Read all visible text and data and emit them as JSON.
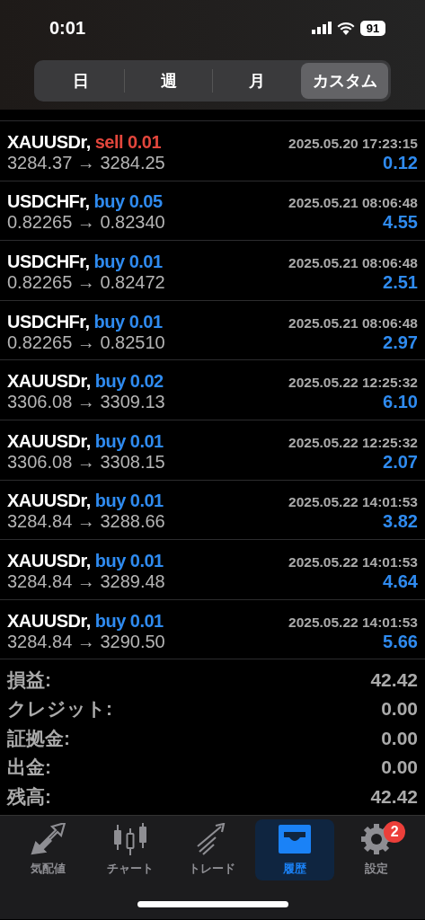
{
  "status_bar": {
    "time": "0:01",
    "battery": "91"
  },
  "period_tabs": [
    {
      "label": "日",
      "selected": false
    },
    {
      "label": "週",
      "selected": false
    },
    {
      "label": "月",
      "selected": false
    },
    {
      "label": "カスタム",
      "selected": true
    }
  ],
  "trades": [
    {
      "symbol": "XAUUSDr,",
      "side": "sell",
      "lot": "0.01",
      "time": "2025.05.20 17:23:15",
      "prices": "3284.37 → 3284.25",
      "profit": "0.12"
    },
    {
      "symbol": "USDCHFr,",
      "side": "buy",
      "lot": "0.05",
      "time": "2025.05.21 08:06:48",
      "prices": "0.82265 → 0.82340",
      "profit": "4.55"
    },
    {
      "symbol": "USDCHFr,",
      "side": "buy",
      "lot": "0.01",
      "time": "2025.05.21 08:06:48",
      "prices": "0.82265 → 0.82472",
      "profit": "2.51"
    },
    {
      "symbol": "USDCHFr,",
      "side": "buy",
      "lot": "0.01",
      "time": "2025.05.21 08:06:48",
      "prices": "0.82265 → 0.82510",
      "profit": "2.97"
    },
    {
      "symbol": "XAUUSDr,",
      "side": "buy",
      "lot": "0.02",
      "time": "2025.05.22 12:25:32",
      "prices": "3306.08 → 3309.13",
      "profit": "6.10"
    },
    {
      "symbol": "XAUUSDr,",
      "side": "buy",
      "lot": "0.01",
      "time": "2025.05.22 12:25:32",
      "prices": "3306.08 → 3308.15",
      "profit": "2.07"
    },
    {
      "symbol": "XAUUSDr,",
      "side": "buy",
      "lot": "0.01",
      "time": "2025.05.22 14:01:53",
      "prices": "3284.84 → 3288.66",
      "profit": "3.82"
    },
    {
      "symbol": "XAUUSDr,",
      "side": "buy",
      "lot": "0.01",
      "time": "2025.05.22 14:01:53",
      "prices": "3284.84 → 3289.48",
      "profit": "4.64"
    },
    {
      "symbol": "XAUUSDr,",
      "side": "buy",
      "lot": "0.01",
      "time": "2025.05.22 14:01:53",
      "prices": "3284.84 → 3290.50",
      "profit": "5.66"
    }
  ],
  "summary": [
    {
      "label": "損益:",
      "value": "42.42"
    },
    {
      "label": "クレジット:",
      "value": "0.00"
    },
    {
      "label": "証拠金:",
      "value": "0.00"
    },
    {
      "label": "出金:",
      "value": "0.00"
    },
    {
      "label": "残高:",
      "value": "42.42"
    }
  ],
  "tab_bar": [
    {
      "kind": "quotes",
      "label": "気配値",
      "selected": false
    },
    {
      "kind": "chart",
      "label": "チャート",
      "selected": false
    },
    {
      "kind": "trade",
      "label": "トレード",
      "selected": false
    },
    {
      "kind": "history",
      "label": "履歴",
      "selected": true
    },
    {
      "kind": "settings",
      "label": "設定",
      "selected": false,
      "badge": "2"
    }
  ]
}
